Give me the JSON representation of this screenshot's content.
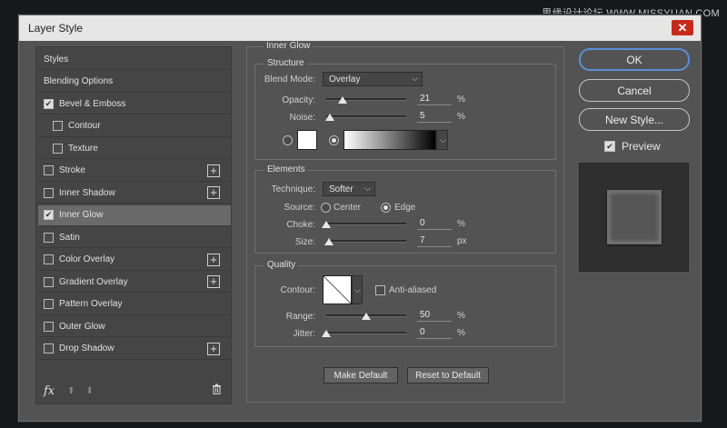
{
  "watermark": "思缘设计论坛 WWW.MISSYUAN.COM",
  "window": {
    "title": "Layer Style",
    "close_glyph": "✕"
  },
  "left_panel": {
    "items": [
      {
        "label": "Styles",
        "has_checkbox": false,
        "checked": false,
        "has_plus": false,
        "selected": false,
        "indent": false
      },
      {
        "label": "Blending Options",
        "has_checkbox": false,
        "checked": false,
        "has_plus": false,
        "selected": false,
        "indent": false
      },
      {
        "label": "Bevel & Emboss",
        "has_checkbox": true,
        "checked": true,
        "has_plus": false,
        "selected": false,
        "indent": false
      },
      {
        "label": "Contour",
        "has_checkbox": true,
        "checked": false,
        "has_plus": false,
        "selected": false,
        "indent": true
      },
      {
        "label": "Texture",
        "has_checkbox": true,
        "checked": false,
        "has_plus": false,
        "selected": false,
        "indent": true
      },
      {
        "label": "Stroke",
        "has_checkbox": true,
        "checked": false,
        "has_plus": true,
        "selected": false,
        "indent": false
      },
      {
        "label": "Inner Shadow",
        "has_checkbox": true,
        "checked": false,
        "has_plus": true,
        "selected": false,
        "indent": false
      },
      {
        "label": "Inner Glow",
        "has_checkbox": true,
        "checked": true,
        "has_plus": false,
        "selected": true,
        "indent": false
      },
      {
        "label": "Satin",
        "has_checkbox": true,
        "checked": false,
        "has_plus": false,
        "selected": false,
        "indent": false
      },
      {
        "label": "Color Overlay",
        "has_checkbox": true,
        "checked": false,
        "has_plus": true,
        "selected": false,
        "indent": false
      },
      {
        "label": "Gradient Overlay",
        "has_checkbox": true,
        "checked": false,
        "has_plus": true,
        "selected": false,
        "indent": false
      },
      {
        "label": "Pattern Overlay",
        "has_checkbox": true,
        "checked": false,
        "has_plus": false,
        "selected": false,
        "indent": false
      },
      {
        "label": "Outer Glow",
        "has_checkbox": true,
        "checked": false,
        "has_plus": false,
        "selected": false,
        "indent": false
      },
      {
        "label": "Drop Shadow",
        "has_checkbox": true,
        "checked": false,
        "has_plus": true,
        "selected": false,
        "indent": false
      }
    ],
    "footer": {
      "fx": "fx",
      "up_glyph": "⬆",
      "down_glyph": "⬇",
      "trash_glyph": "🗑"
    },
    "check_glyph": "✔",
    "plus_glyph": "+"
  },
  "inner_glow": {
    "title": "Inner Glow",
    "structure": {
      "title": "Structure",
      "blend_mode_label": "Blend Mode:",
      "blend_mode_value": "Overlay",
      "opacity_label": "Opacity:",
      "opacity_value": "21",
      "opacity_fraction": 0.21,
      "noise_label": "Noise:",
      "noise_value": "5",
      "noise_fraction": 0.05,
      "percent": "%"
    },
    "elements": {
      "title": "Elements",
      "technique_label": "Technique:",
      "technique_value": "Softer",
      "source_label": "Source:",
      "source_center": "Center",
      "source_edge": "Edge",
      "choke_label": "Choke:",
      "choke_value": "0",
      "choke_fraction": 0.0,
      "size_label": "Size:",
      "size_value": "7",
      "size_fraction": 0.03,
      "percent": "%",
      "px": "px"
    },
    "quality": {
      "title": "Quality",
      "contour_label": "Contour:",
      "anti_aliased_label": "Anti-aliased",
      "range_label": "Range:",
      "range_value": "50",
      "range_fraction": 0.5,
      "jitter_label": "Jitter:",
      "jitter_value": "0",
      "jitter_fraction": 0.0,
      "percent": "%"
    },
    "make_default": "Make Default",
    "reset_default": "Reset to Default"
  },
  "right": {
    "ok": "OK",
    "cancel": "Cancel",
    "new_style": "New Style...",
    "preview_label": "Preview",
    "preview_checked": true
  },
  "colors": {
    "accent": "#5b8fd6",
    "close": "#c42b1c",
    "panel": "#535353"
  }
}
